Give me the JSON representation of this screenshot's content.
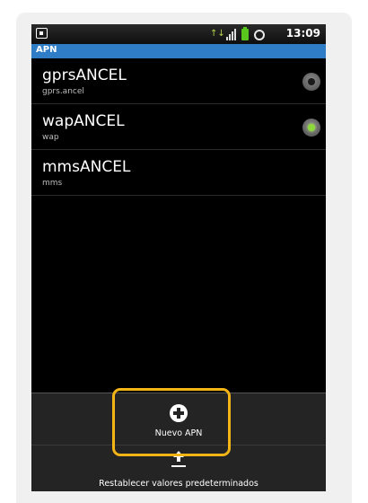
{
  "statusbar": {
    "time": "13:09",
    "data_indicator": "↑↓"
  },
  "title": "APN",
  "apns": [
    {
      "name": "gprsANCEL",
      "apn": "gprs.ancel",
      "selected": false
    },
    {
      "name": "wapANCEL",
      "apn": "wap",
      "selected": true
    },
    {
      "name": "mmsANCEL",
      "apn": "mms"
    }
  ],
  "menu": {
    "new_apn": "Nuevo APN",
    "reset": "Restablecer valores predeterminados"
  },
  "colors": {
    "titlebar": "#2f7dc6",
    "highlight": "#f3b417",
    "radio_on": "#8ddb3a"
  }
}
